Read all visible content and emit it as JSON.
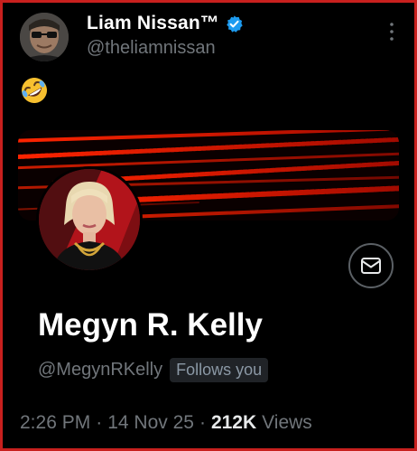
{
  "author": {
    "display_name": "Liam Nissan™",
    "handle": "@theliamnissan",
    "avatar_icon": "man-in-sunglasses-avatar",
    "verified_icon": "verified-badge-icon",
    "verified_color": "#1d9bf0"
  },
  "tweet": {
    "emoji": "🤣",
    "emoji_name": "rolling-on-floor-laughing-emoji"
  },
  "profile_card": {
    "name": "Megyn R. Kelly",
    "handle": "@MegynRKelly",
    "follows_badge": "Follows you",
    "message_icon": "envelope-icon",
    "banner_colors": [
      "#ff1a00",
      "#0a0000"
    ]
  },
  "meta": {
    "time": "2:26 PM",
    "separator_1": "·",
    "date": "14 Nov 25",
    "separator_2": "·",
    "views_count": "212K",
    "views_label": "Views"
  },
  "colors": {
    "background": "#000000",
    "frame_border": "#c8201e",
    "secondary_text": "#71767b"
  }
}
